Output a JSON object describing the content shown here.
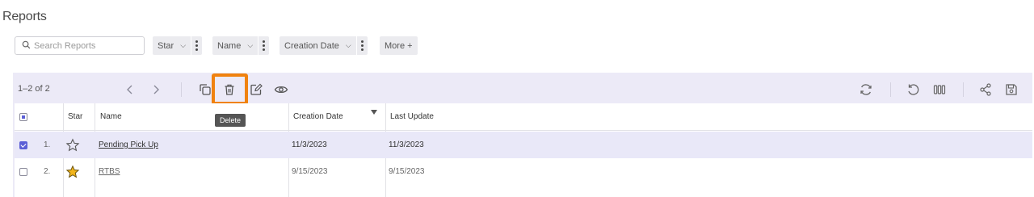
{
  "page": {
    "title": "Reports"
  },
  "filters": {
    "search_placeholder": "Search Reports",
    "chips": [
      "Star",
      "Name",
      "Creation Date"
    ],
    "more_label": "More +"
  },
  "toolbar": {
    "range": "1–2 of 2",
    "tooltip": "Delete",
    "highlight_color": "#f0820f"
  },
  "table": {
    "columns": [
      "Star",
      "Name",
      "Creation Date",
      "Last Update"
    ],
    "rows": [
      {
        "index": "1.",
        "selected": true,
        "starred": false,
        "name": "Pending Pick Up",
        "creation_date": "11/3/2023",
        "last_update": "11/3/2023"
      },
      {
        "index": "2.",
        "selected": false,
        "starred": true,
        "name": "RTBS",
        "creation_date": "9/15/2023",
        "last_update": "9/15/2023"
      }
    ]
  },
  "colors": {
    "panel_bg": "#eceaf7",
    "selected_row": "#e9e8f8",
    "accent": "#5b5fd6",
    "star_fill": "#f2b51b"
  }
}
